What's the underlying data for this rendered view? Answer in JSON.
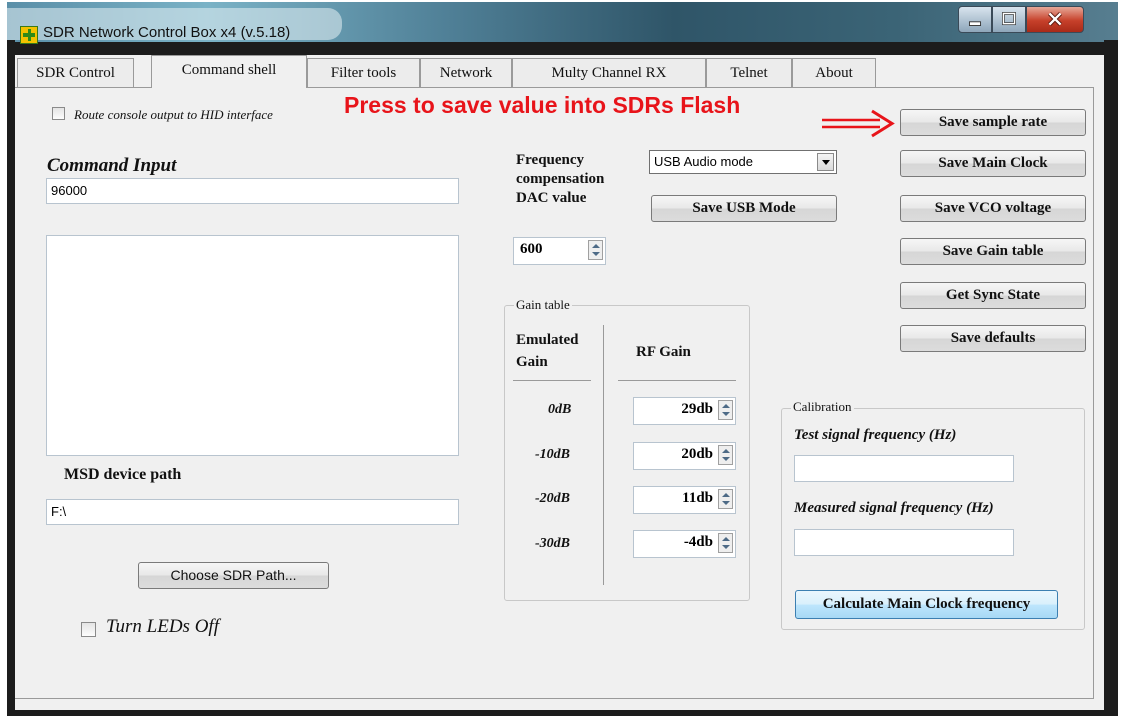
{
  "window": {
    "title": "SDR Network Control Box x4 (v.5.18)"
  },
  "tabs": [
    {
      "label": "SDR Control"
    },
    {
      "label": "Command shell"
    },
    {
      "label": "Filter tools"
    },
    {
      "label": "Network"
    },
    {
      "label": "Multy Channel RX"
    },
    {
      "label": "Telnet"
    },
    {
      "label": "About"
    }
  ],
  "active_tab": "Command shell",
  "annotation": {
    "text": "Press to save value into SDRs Flash",
    "color": "#e8141a"
  },
  "console": {
    "route_checkbox_label": "Route console output to HID interface",
    "route_checked": false,
    "command_input_label": "Command Input",
    "command_value": "96000",
    "output_text": ""
  },
  "msd": {
    "label": "MSD device path",
    "path_value": "F:\\",
    "choose_button": "Choose SDR Path...",
    "leds_label": "Turn LEDs Off",
    "leds_checked": false
  },
  "frequency": {
    "label_line1": "Frequency",
    "label_line2": "compensation",
    "label_line3": "DAC value",
    "dac_value": "600",
    "usb_mode_selected": "USB Audio mode",
    "save_usb_button": "Save USB Mode"
  },
  "gain_table": {
    "caption": "Gain table",
    "emulated_header_1": "Emulated",
    "emulated_header_2": "Gain",
    "rf_header": "RF Gain",
    "rows": [
      {
        "emulated": "0dB",
        "rf": "29db"
      },
      {
        "emulated": "-10dB",
        "rf": "20db"
      },
      {
        "emulated": "-20dB",
        "rf": "11db"
      },
      {
        "emulated": "-30dB",
        "rf": "-4db"
      }
    ]
  },
  "actions": [
    {
      "label": "Save sample rate"
    },
    {
      "label": "Save Main Clock"
    },
    {
      "label": "Save VCO voltage"
    },
    {
      "label": "Save Gain table"
    },
    {
      "label": "Get Sync State"
    },
    {
      "label": "Save defaults"
    }
  ],
  "calibration": {
    "caption": "Calibration",
    "test_label": "Test signal frequency (Hz)",
    "test_value": "",
    "measured_label": "Measured signal frequency (Hz)",
    "measured_value": "",
    "calc_button": "Calculate Main Clock frequency"
  }
}
